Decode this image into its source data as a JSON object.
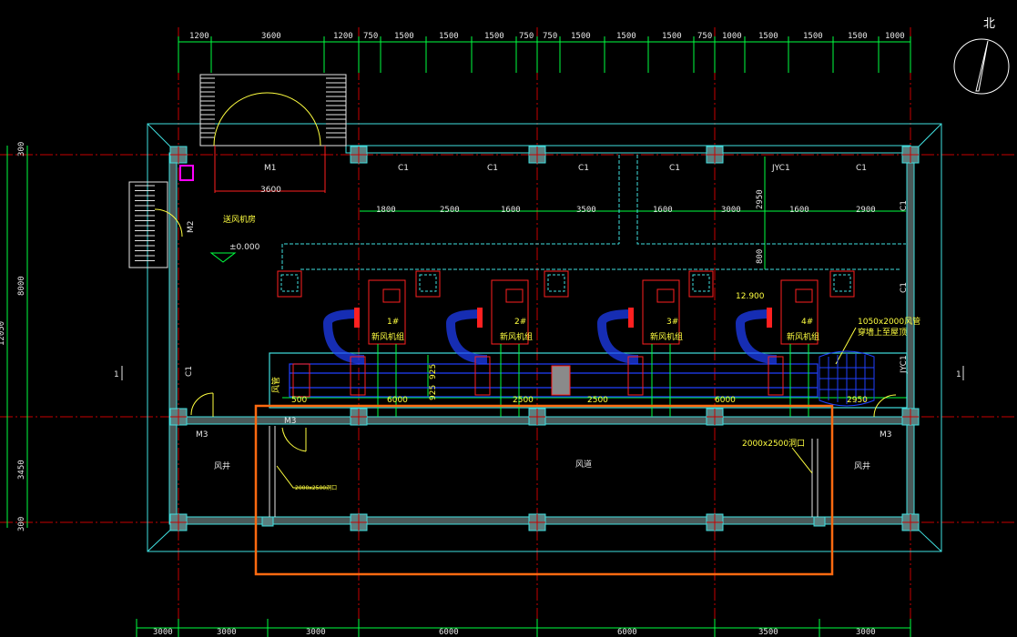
{
  "colors": {
    "background": "#000000",
    "axis_red": "#c80000",
    "green_dim": "#00ff40",
    "cyan_outline": "#40e0e0",
    "duct_blue": "#2040ff",
    "unit_red": "#ff2020",
    "label_yellow": "#ffff40",
    "selection_orange": "#ff6a10",
    "north_white": "#ffffff",
    "door_magenta": "#ff00ff"
  },
  "top_dimensions": [
    "1200",
    "3600",
    "1200",
    "750",
    "1500",
    "1500",
    "1500",
    "750",
    "750",
    "1500",
    "1500",
    "1500",
    "750",
    "1000",
    "1500",
    "1500",
    "1500",
    "1000"
  ],
  "bottom_dimensions": [
    "3000",
    "3000",
    "6000",
    "6000",
    "3500",
    "3000"
  ],
  "left_dimensions": [
    "300",
    "8000",
    "3450",
    "300"
  ],
  "left_outer_dimension": "12050",
  "north_label": "北",
  "doors": {
    "m1": "M1",
    "m1_width": "3600",
    "m2": "M2",
    "m3_left": "M3",
    "m3_mid": "M3",
    "m3_right": "M3"
  },
  "windows": [
    "C1",
    "C1",
    "C1",
    "C1",
    "JYC1",
    "C1"
  ],
  "side_windows": {
    "left": "C1",
    "right_top": "C1",
    "right_mid": "C1",
    "right_lower": "JYC1"
  },
  "room_labels": {
    "machine_room": "送风机房",
    "air_left": "风井",
    "air_mid": "风道",
    "air_right": "风井"
  },
  "elevation": "±0.000",
  "duct_dimensions": [
    "1800",
    "2500",
    "1600",
    "3500",
    "1600",
    "3000",
    "1600",
    "2900"
  ],
  "vertical_dimensions": {
    "upper": "2950",
    "lower": "800"
  },
  "fan_units": [
    {
      "id": "1#",
      "name": "新风机组"
    },
    {
      "id": "2#",
      "name": "新风机组"
    },
    {
      "id": "3#",
      "name": "新风机组"
    },
    {
      "id": "4#",
      "name": "新风机组"
    }
  ],
  "equipment_note": "12.900",
  "duct_note_line1": "1050x2000风管",
  "duct_note_line2": "穿墙上至屋顶",
  "bottom_row_dims": [
    "500",
    "6000",
    "2500",
    "2500",
    "6000",
    "2950"
  ],
  "mid_vertical_dims": [
    "925",
    "925"
  ],
  "opening_right": "2000x2500洞口",
  "opening_left": "2000x2500洞口",
  "section_marks": {
    "left": "1",
    "right": "1"
  },
  "left_small_label": "风管",
  "right_small_label": "风管"
}
